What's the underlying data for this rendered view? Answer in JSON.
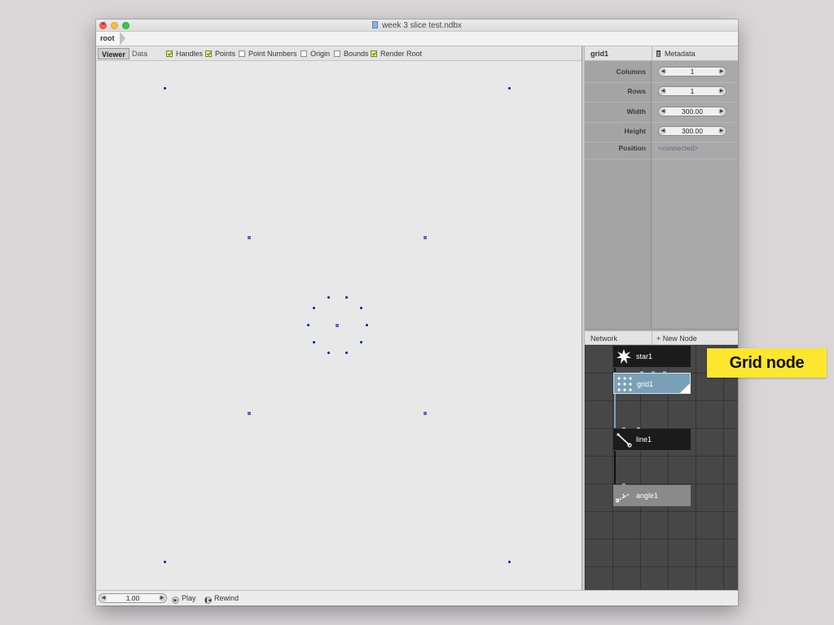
{
  "window": {
    "title": "week 3 slice test.ndbx"
  },
  "breadcrumb": {
    "root": "root"
  },
  "viewer": {
    "tabs": {
      "viewer": "Viewer",
      "data": "Data"
    },
    "options": [
      {
        "label": "Handles",
        "checked": true
      },
      {
        "label": "Points",
        "checked": true
      },
      {
        "label": "Point Numbers",
        "checked": false
      },
      {
        "label": "Origin",
        "checked": false
      },
      {
        "label": "Bounds",
        "checked": false
      },
      {
        "label": "Render Root",
        "checked": true
      }
    ],
    "point_color": "#0b12c8",
    "handle_color": "#6a63c8"
  },
  "ports": {
    "node_name": "grid1",
    "metadata_label": "Metadata",
    "params": [
      {
        "label": "Columns",
        "value": "1"
      },
      {
        "label": "Rows",
        "value": "1"
      },
      {
        "label": "Width",
        "value": "300.00"
      },
      {
        "label": "Height",
        "value": "300.00"
      },
      {
        "label": "Position",
        "value": "<connected>"
      }
    ]
  },
  "network": {
    "title": "Network",
    "new_node": "New Node",
    "nodes": [
      {
        "name": "star1",
        "icon": "star-icon"
      },
      {
        "name": "grid1",
        "icon": "grid-icon",
        "selected": true
      },
      {
        "name": "line1",
        "icon": "line-icon"
      },
      {
        "name": "angle1",
        "icon": "angle-icon"
      }
    ],
    "selected_color": "#7aa0b8"
  },
  "playback": {
    "frame": "1.00",
    "play": "Play",
    "rewind": "Rewind"
  },
  "callout": {
    "text": "Grid node",
    "color": "#fde72e"
  }
}
